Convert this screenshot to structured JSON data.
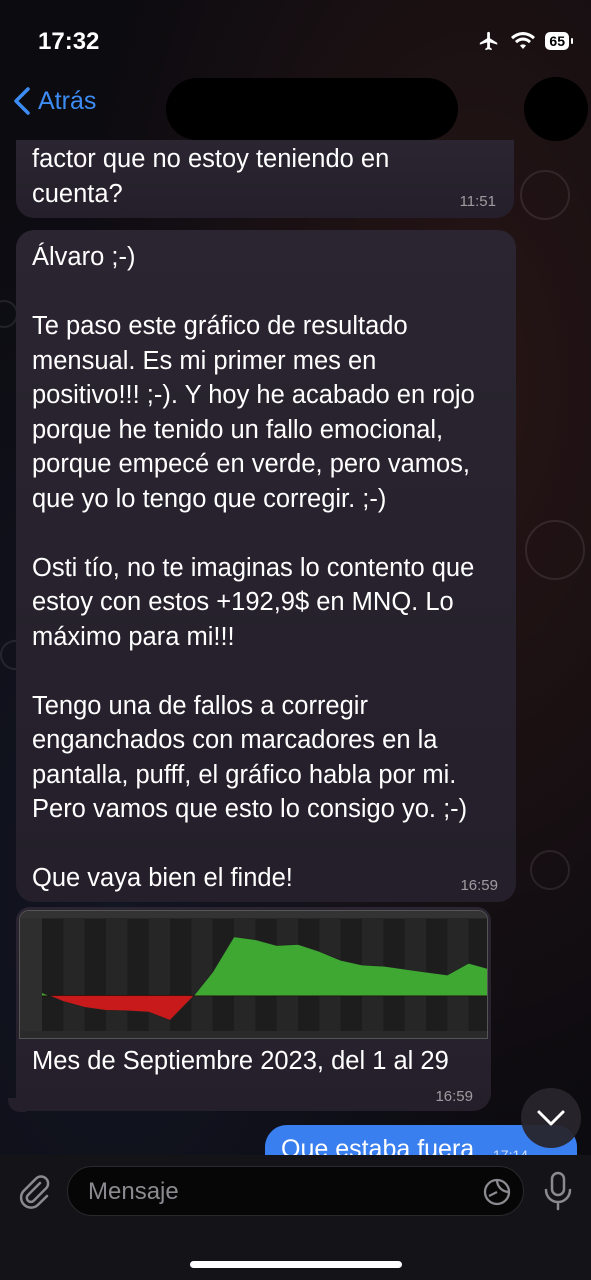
{
  "status_bar": {
    "time": "17:32",
    "battery": "65"
  },
  "nav": {
    "back_label": "Atrás"
  },
  "messages": [
    {
      "text": "factor que no estoy teniendo en\ncuenta?",
      "time": "11:51"
    },
    {
      "text": "Álvaro ;-)\n\nTe paso este gráfico de resultado\nmensual. Es mi primer mes en\npositivo!!! ;-). Y hoy he acabado en rojo\nporque he tenido un fallo emocional,\nporque empecé en verde, pero vamos,\nque yo lo tengo que corregir. ;-)\n\nOsti tío, no te imaginas lo contento que\nestoy con estos +192,9$ en MNQ. Lo\nmáximo para mi!!!\n\nTengo una de fallos a corregir\nenganchados con marcadores en la\npantalla, pufff, el gráfico habla por mi.\nPero vamos que esto lo consigo yo. ;-)\n\nQue vaya bien el finde!",
      "time": "16:59"
    },
    {
      "caption": "Mes de Septiembre 2023, del 1 al 29",
      "time": "16:59"
    }
  ],
  "outgoing": {
    "text": "Que estaba fuera",
    "time": "17:14"
  },
  "input": {
    "placeholder": "Mensaje"
  },
  "colors": {
    "accent": "#3d8cf4",
    "positive": "#3ea832",
    "negative": "#c81a1a",
    "outgoing_bubble": "#3a7ff0"
  },
  "chart_data": {
    "type": "area",
    "title": "",
    "x": [
      1,
      2,
      3,
      4,
      5,
      6,
      7,
      8,
      9,
      10,
      11,
      12,
      13,
      14,
      15,
      16,
      17,
      18,
      19,
      20,
      21,
      22
    ],
    "values": [
      5,
      -10,
      -20,
      -25,
      -26,
      -28,
      -42,
      -5,
      40,
      100,
      95,
      85,
      87,
      75,
      60,
      52,
      50,
      45,
      40,
      35,
      55,
      45
    ],
    "ylim": [
      -60,
      130
    ]
  }
}
